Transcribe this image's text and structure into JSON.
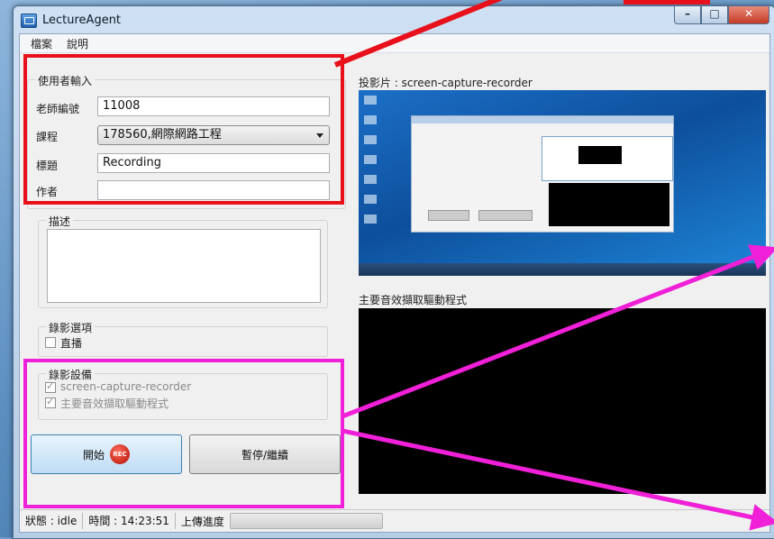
{
  "window": {
    "title": "LectureAgent",
    "min": "–",
    "max": "□",
    "close": "✕"
  },
  "menu": {
    "items": [
      "檔案",
      "說明"
    ]
  },
  "user_input": {
    "legend": "使用者輸入",
    "teacher_id_label": "老師編號",
    "teacher_id_value": "11008",
    "course_label": "課程",
    "course_value": "178560,網際網路工程",
    "title_label": "標題",
    "title_value": "Recording",
    "author_label": "作者",
    "author_value": ""
  },
  "description": {
    "legend": "描述"
  },
  "record_options": {
    "legend": "錄影選項",
    "live_label": "直播",
    "live_checked": false
  },
  "record_devices": {
    "legend": "錄影設備",
    "items": [
      {
        "label": "screen-capture-recorder",
        "checked": true
      },
      {
        "label": "主要音效擷取驅動程式",
        "checked": true
      }
    ]
  },
  "buttons": {
    "start_label": "開始",
    "rec_badge": "REC",
    "pause_label": "暫停/繼續"
  },
  "previews": {
    "slides_label": "投影片 : screen-capture-recorder",
    "audio_label": "主要音效擷取驅動程式"
  },
  "status": {
    "state": "狀態 : idle",
    "time": "時間 : 14:23:51",
    "upload_label": "上傳進度",
    "upload_progress": 0
  },
  "colors": {
    "red_highlight": "#e8101a",
    "magenta_highlight": "#f01fd8"
  }
}
